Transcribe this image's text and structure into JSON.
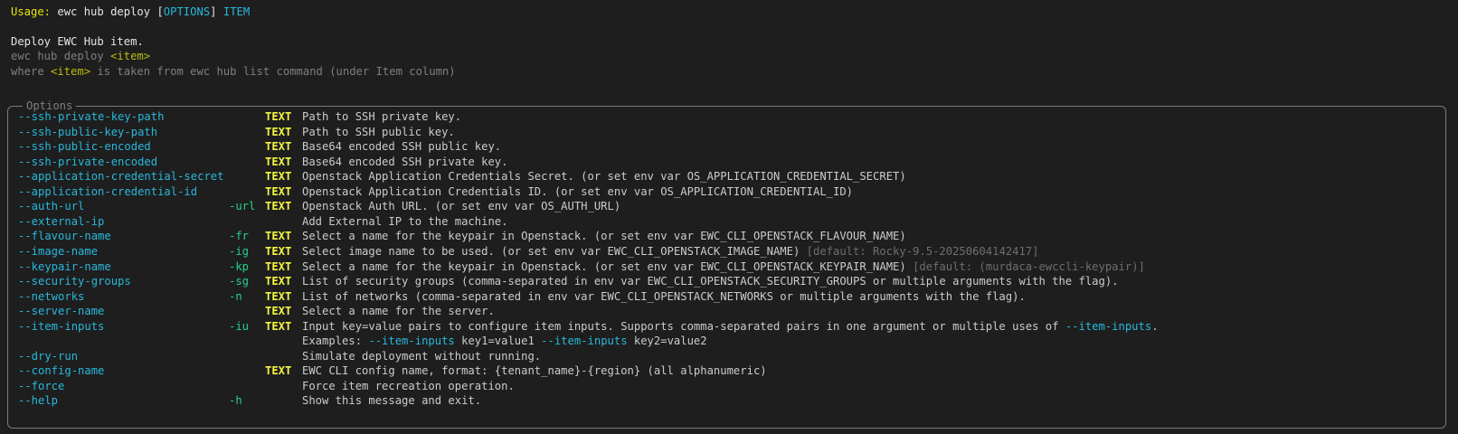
{
  "usage": {
    "label": "Usage:",
    "command": "ewc hub deploy",
    "bracket_open": "[",
    "options": "OPTIONS",
    "bracket_close": "]",
    "item": "ITEM"
  },
  "description": {
    "title": "Deploy EWC Hub item.",
    "line2_prefix": "ewc hub deploy ",
    "line2_item": "<item>",
    "line3_prefix": "where ",
    "line3_item": "<item>",
    "line3_suffix": " is taken from ewc hub list command (under Item column)"
  },
  "panel": {
    "title": "Options",
    "rows": [
      {
        "opt": "--ssh-private-key-path",
        "short": "",
        "type": "TEXT",
        "help": "Path to SSH private key.",
        "default": ""
      },
      {
        "opt": "--ssh-public-key-path",
        "short": "",
        "type": "TEXT",
        "help": "Path to SSH public key.",
        "default": ""
      },
      {
        "opt": "--ssh-public-encoded",
        "short": "",
        "type": "TEXT",
        "help": "Base64 encoded SSH public key.",
        "default": ""
      },
      {
        "opt": "--ssh-private-encoded",
        "short": "",
        "type": "TEXT",
        "help": "Base64 encoded SSH private key.",
        "default": ""
      },
      {
        "opt": "--application-credential-secret",
        "short": "",
        "type": "TEXT",
        "help": "Openstack Application Credentials Secret. (or set env var OS_APPLICATION_CREDENTIAL_SECRET)",
        "default": ""
      },
      {
        "opt": "--application-credential-id",
        "short": "",
        "type": "TEXT",
        "help": "Openstack Application Credentials ID. (or set env var OS_APPLICATION_CREDENTIAL_ID)",
        "default": ""
      },
      {
        "opt": "--auth-url",
        "short": "-url",
        "type": "TEXT",
        "help": "Openstack Auth URL. (or set env var OS_AUTH_URL)",
        "default": ""
      },
      {
        "opt": "--external-ip",
        "short": "",
        "type": "",
        "help": "Add External IP to the machine.",
        "default": ""
      },
      {
        "opt": "--flavour-name",
        "short": "-fr",
        "type": "TEXT",
        "help": "Select a name for the keypair in Openstack. (or set env var EWC_CLI_OPENSTACK_FLAVOUR_NAME)",
        "default": ""
      },
      {
        "opt": "--image-name",
        "short": "-ig",
        "type": "TEXT",
        "help": "Select image name to be used. (or set env var EWC_CLI_OPENSTACK_IMAGE_NAME) ",
        "default": "[default: Rocky-9.5-20250604142417]"
      },
      {
        "opt": "--keypair-name",
        "short": "-kp",
        "type": "TEXT",
        "help": "Select a name for the keypair in Openstack. (or set env var EWC_CLI_OPENSTACK_KEYPAIR_NAME) ",
        "default": "[default: (murdaca-ewccli-keypair)]"
      },
      {
        "opt": "--security-groups",
        "short": "-sg",
        "type": "TEXT",
        "help": "List of security groups (comma-separated in env var EWC_CLI_OPENSTACK_SECURITY_GROUPS or multiple arguments with the flag).",
        "default": ""
      },
      {
        "opt": "--networks",
        "short": "-n",
        "type": "TEXT",
        "help": "List of networks (comma-separated in env var EWC_CLI_OPENSTACK_NETWORKS or multiple arguments with the flag).",
        "default": ""
      },
      {
        "opt": "--server-name",
        "short": "",
        "type": "TEXT",
        "help": "Select a name for the server.",
        "default": ""
      },
      {
        "opt": "--item-inputs",
        "short": "-iu",
        "type": "TEXT",
        "help": "Input key=value pairs to configure item inputs. Supports comma-separated pairs in one argument or multiple uses of ",
        "help_flag": "--item-inputs",
        "help_end": ".",
        "default": ""
      },
      {
        "opt": "",
        "short": "",
        "type": "",
        "help": "",
        "default": ""
      },
      {
        "opt": "--dry-run",
        "short": "",
        "type": "",
        "help": "Simulate deployment without running.",
        "default": ""
      },
      {
        "opt": "--config-name",
        "short": "",
        "type": "TEXT",
        "help": "EWC CLI config name, format: {tenant_name}-{region} (all alphanumeric)",
        "default": ""
      },
      {
        "opt": "--force",
        "short": "",
        "type": "",
        "help": "Force item recreation operation.",
        "default": ""
      },
      {
        "opt": "--help",
        "short": "-h",
        "type": "",
        "help": "Show this message and exit.",
        "default": ""
      }
    ],
    "examples": {
      "prefix": "Examples: ",
      "flag1": "--item-inputs",
      "val1": " key1=value1 ",
      "flag2": "--item-inputs",
      "val2": " key2=value2"
    }
  }
}
